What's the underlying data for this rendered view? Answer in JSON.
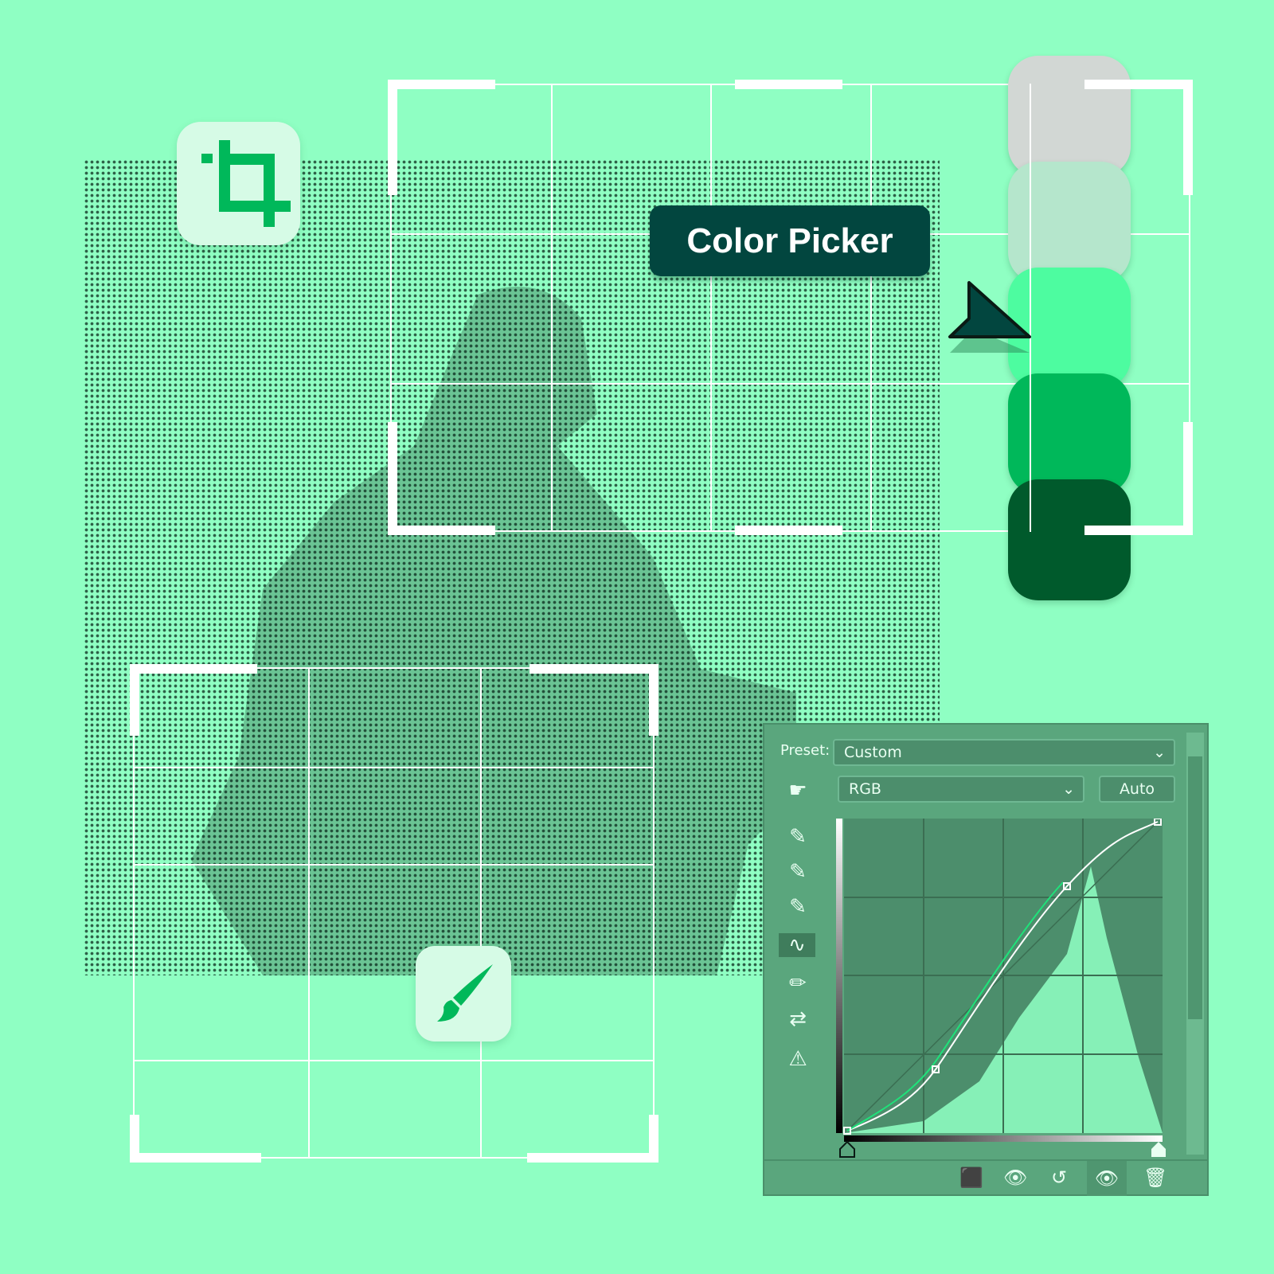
{
  "colors": {
    "background": "#8fffc3",
    "label_bg": "#02463f",
    "swatches": [
      "#d2d7d4",
      "#b5e6cc",
      "#4dfca0",
      "#00b85a",
      "#005a2c"
    ],
    "panel_bg": "#5aa67d"
  },
  "icons": {
    "crop": "crop-icon",
    "brush": "paintbrush-icon",
    "cursor": "cursor-arrow-icon"
  },
  "label": {
    "text": "Color Picker"
  },
  "curves": {
    "preset_label": "Preset:",
    "preset_value": "Custom",
    "channel_value": "RGB",
    "auto_label": "Auto",
    "tools": [
      "on-image-adjust-icon",
      "eyedropper-black-icon",
      "eyedropper-gray-icon",
      "eyedropper-white-icon",
      "curve-point-icon",
      "pencil-icon",
      "smooth-icon",
      "clipping-warning-icon"
    ],
    "footer": [
      "clip-to-layer-icon",
      "view-previous-icon",
      "reset-icon",
      "visibility-icon",
      "trash-icon"
    ]
  }
}
